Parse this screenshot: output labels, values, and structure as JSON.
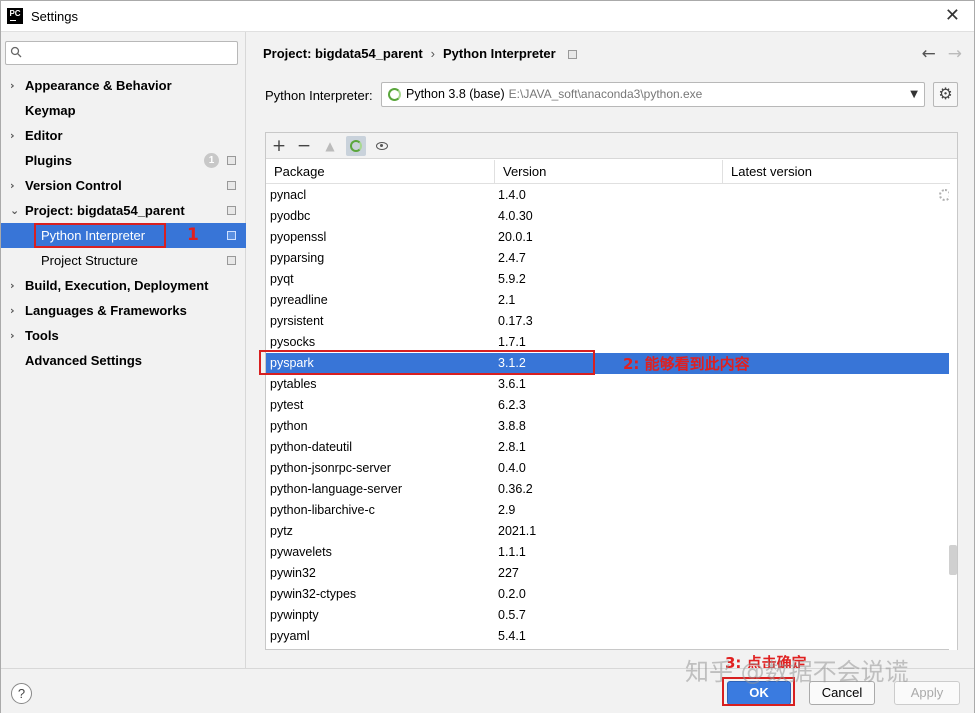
{
  "window": {
    "title": "Settings",
    "logo_text": "PC"
  },
  "sidebar": {
    "search_placeholder": "",
    "items": [
      {
        "label": "Appearance & Behavior",
        "chevron": "›",
        "bold": true
      },
      {
        "label": "Keymap",
        "chevron": "",
        "bold": true
      },
      {
        "label": "Editor",
        "chevron": "›",
        "bold": true
      },
      {
        "label": "Plugins",
        "chevron": "",
        "bold": true,
        "badge": "1"
      },
      {
        "label": "Version Control",
        "chevron": "›",
        "bold": true
      },
      {
        "label": "Project: bigdata54_parent",
        "chevron": "⌄",
        "bold": true
      },
      {
        "label": "Python Interpreter",
        "child": true,
        "selected": true
      },
      {
        "label": "Project Structure",
        "child": true
      },
      {
        "label": "Build, Execution, Deployment",
        "chevron": "›",
        "bold": true
      },
      {
        "label": "Languages & Frameworks",
        "chevron": "›",
        "bold": true
      },
      {
        "label": "Tools",
        "chevron": "›",
        "bold": true
      },
      {
        "label": "Advanced Settings",
        "chevron": "",
        "bold": true
      }
    ]
  },
  "breadcrumb": {
    "project": "Project: bigdata54_parent",
    "sep": "›",
    "page": "Python Interpreter"
  },
  "interpreter": {
    "label": "Python Interpreter:",
    "value": "Python 3.8 (base)",
    "path": "E:\\JAVA_soft\\anaconda3\\python.exe"
  },
  "table": {
    "headers": [
      "Package",
      "Version",
      "Latest version"
    ],
    "rows": [
      [
        "pynacl",
        "1.4.0"
      ],
      [
        "pyodbc",
        "4.0.30"
      ],
      [
        "pyopenssl",
        "20.0.1"
      ],
      [
        "pyparsing",
        "2.4.7"
      ],
      [
        "pyqt",
        "5.9.2"
      ],
      [
        "pyreadline",
        "2.1"
      ],
      [
        "pyrsistent",
        "0.17.3"
      ],
      [
        "pysocks",
        "1.7.1"
      ],
      [
        "pyspark",
        "3.1.2"
      ],
      [
        "pytables",
        "3.6.1"
      ],
      [
        "pytest",
        "6.2.3"
      ],
      [
        "python",
        "3.8.8"
      ],
      [
        "python-dateutil",
        "2.8.1"
      ],
      [
        "python-jsonrpc-server",
        "0.4.0"
      ],
      [
        "python-language-server",
        "0.36.2"
      ],
      [
        "python-libarchive-c",
        "2.9"
      ],
      [
        "pytz",
        "2021.1"
      ],
      [
        "pywavelets",
        "1.1.1"
      ],
      [
        "pywin32",
        "227"
      ],
      [
        "pywin32-ctypes",
        "0.2.0"
      ],
      [
        "pywinpty",
        "0.5.7"
      ],
      [
        "pyyaml",
        "5.4.1"
      ]
    ],
    "selected_row": 8
  },
  "annotations": {
    "step1": "1",
    "step2": "2: 能够看到此内容",
    "step3": "3: 点击确定"
  },
  "footer": {
    "help": "?",
    "ok": "OK",
    "cancel": "Cancel",
    "apply": "Apply"
  },
  "watermark": "知乎 @数据不会说谎",
  "colors": {
    "selection": "#3875d7",
    "annotation": "#d82020",
    "ok_button": "#3a7be0"
  }
}
